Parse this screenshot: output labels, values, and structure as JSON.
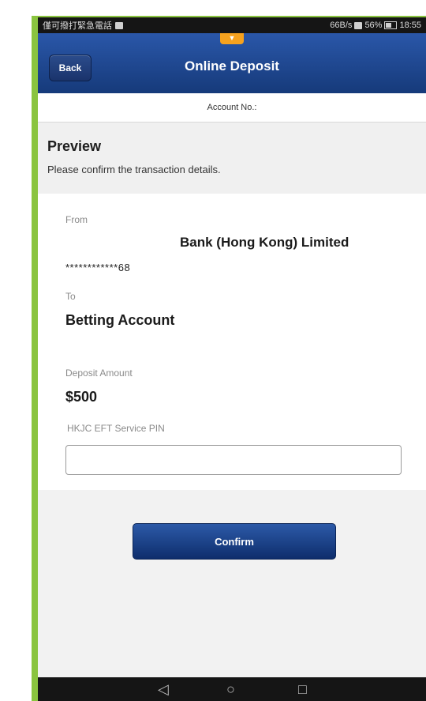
{
  "status_bar": {
    "left_text": "僅可撥打緊急電話",
    "right_text": "66B/s",
    "battery": "56%",
    "time": "18:55"
  },
  "header": {
    "back_label": "Back",
    "title": "Online Deposit"
  },
  "account": {
    "label": "Account No.:"
  },
  "preview": {
    "title": "Preview",
    "subtitle": "Please confirm the transaction details."
  },
  "details": {
    "from_label": "From",
    "bank_name": "Bank (Hong Kong) Limited",
    "from_account": "************68",
    "to_label": "To",
    "to_value": "Betting Account",
    "amount_label": "Deposit Amount",
    "amount_value": "$500",
    "pin_label": "HKJC EFT Service PIN",
    "pin_value": ""
  },
  "actions": {
    "confirm_label": "Confirm"
  },
  "android_nav": {
    "back": "◁",
    "home": "○",
    "recents": "□"
  }
}
